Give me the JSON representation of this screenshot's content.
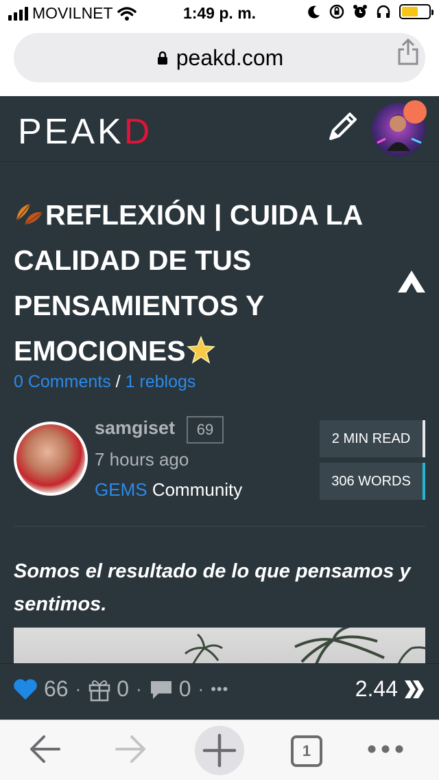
{
  "status_bar": {
    "carrier": "MOVILNET",
    "time": "1:49 p. m."
  },
  "browser": {
    "url": "peakd.com",
    "tab_count": "1"
  },
  "header": {
    "logo_main": "PEAK",
    "logo_end": "D",
    "brand_red": "#e31337"
  },
  "article": {
    "title": "REFLEXIÓN | CUIDA LA CALIDAD DE TUS PENSAMIENTOS Y EMOCIONES",
    "comments_link": "0 Comments",
    "separator": "/",
    "reblogs_link": "1 reblogs",
    "author": "samgiset",
    "reputation": "69",
    "posted": "7 hours ago",
    "community_name": "GEMS",
    "community_suffix": "Community",
    "read_time": "2 MIN READ",
    "word_count": "306 WORDS",
    "intro": "Somos el resultado de lo que pensamos y sentimos."
  },
  "actions": {
    "likes": "66",
    "gifts": "0",
    "comments": "0",
    "more": "•••",
    "payout": "2.44"
  },
  "colors": {
    "background": "#2a353c",
    "link": "#2b8bea",
    "heart": "#1e88e5",
    "notification": "#f57452"
  }
}
